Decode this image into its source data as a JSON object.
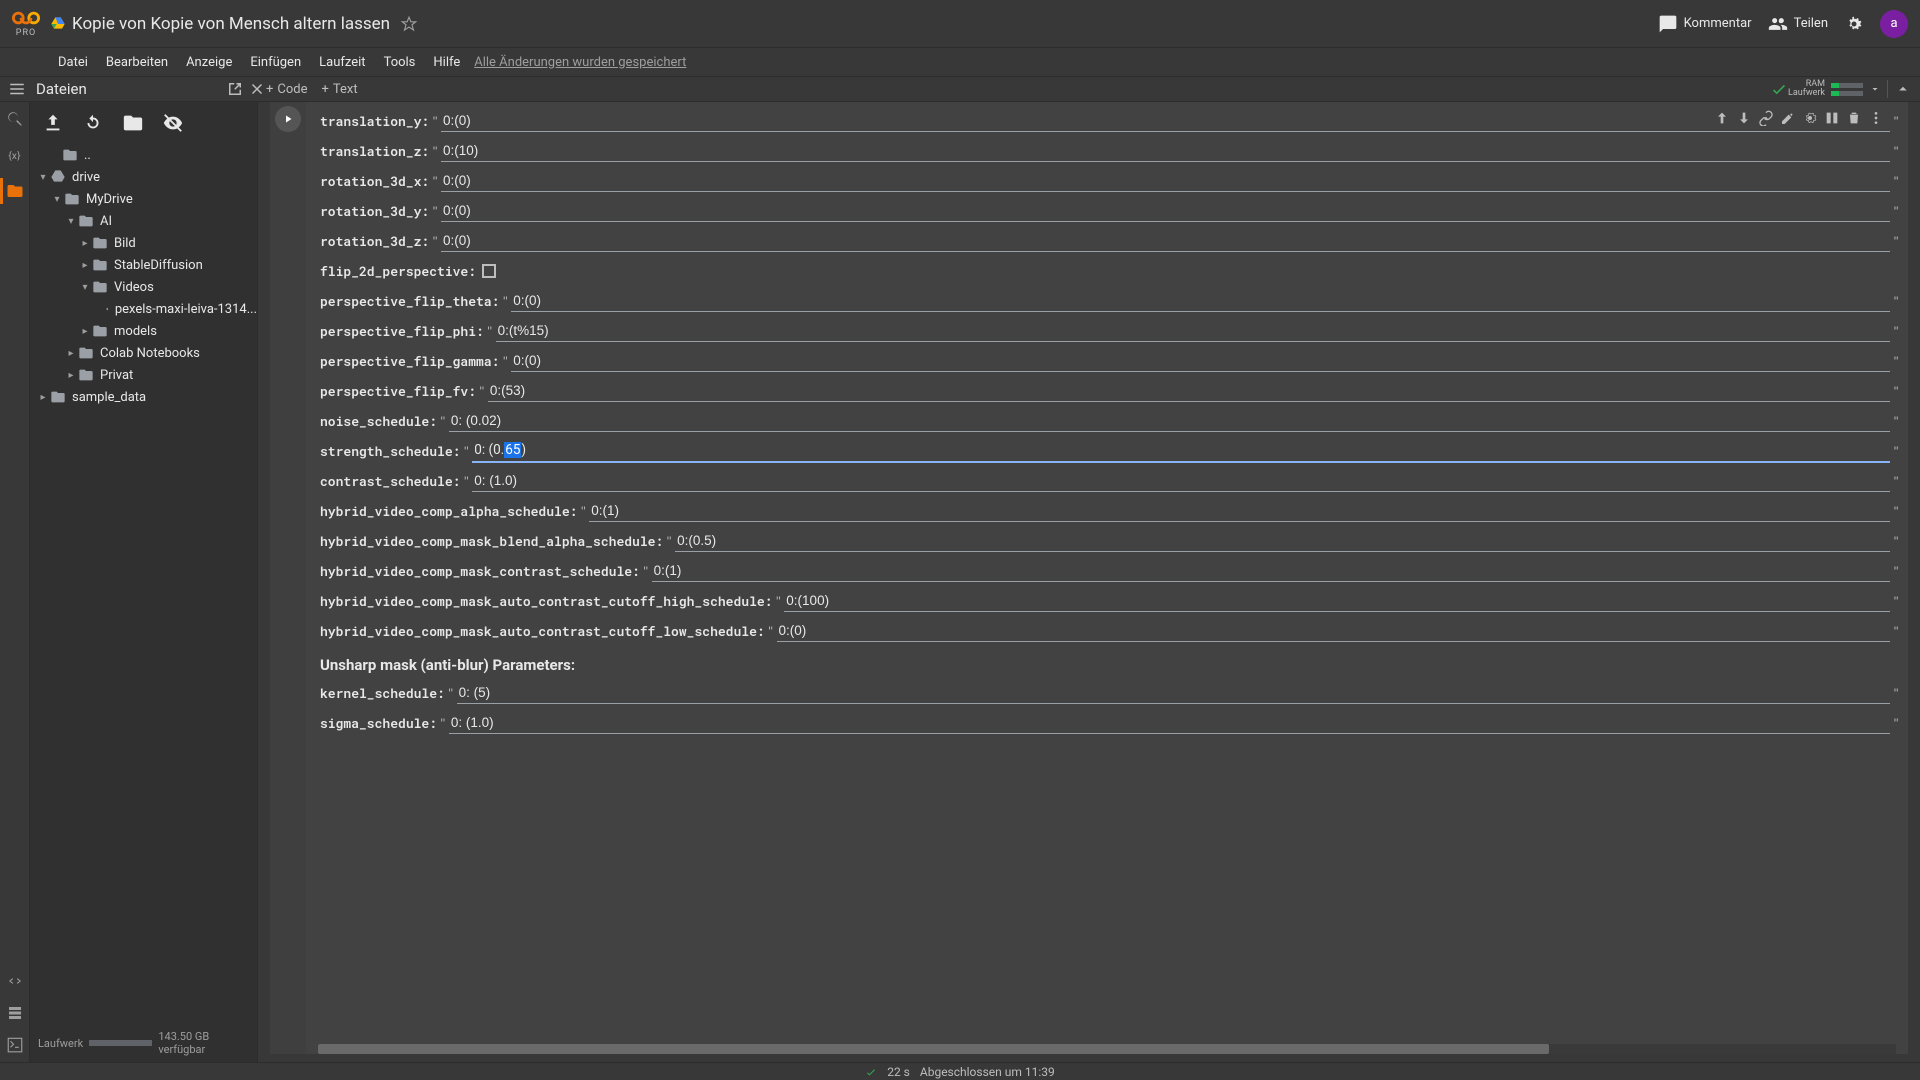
{
  "header": {
    "pro_label": "PRO",
    "doc_title": "Kopie von Kopie von Mensch altern lassen",
    "comment": "Kommentar",
    "share": "Teilen",
    "avatar": "a"
  },
  "menu": {
    "items": [
      "Datei",
      "Bearbeiten",
      "Anzeige",
      "Einfügen",
      "Laufzeit",
      "Tools",
      "Hilfe"
    ],
    "saved": "Alle Änderungen wurden gespeichert"
  },
  "toolrow": {
    "files_title": "Dateien",
    "add_code": "Code",
    "add_text": "Text",
    "ram": "RAM",
    "disk": "Laufwerk"
  },
  "sidebar": {
    "footer_label": "Laufwerk",
    "footer_free": "143.50 GB verfügbar",
    "tree": {
      "dots": "..",
      "drive": "drive",
      "mydrive": "MyDrive",
      "ai": "AI",
      "bild": "Bild",
      "stable": "StableDiffusion",
      "videos": "Videos",
      "videofile": "pexels-maxi-leiva-1314...",
      "models": "models",
      "colab": "Colab Notebooks",
      "privat": "Privat",
      "sample": "sample_data"
    }
  },
  "form": {
    "translation_y": {
      "label": "translation_y:",
      "value": "0:(0)"
    },
    "translation_z": {
      "label": "translation_z:",
      "value": "0:(10)"
    },
    "rotation_3d_x": {
      "label": "rotation_3d_x:",
      "value": "0:(0)"
    },
    "rotation_3d_y": {
      "label": "rotation_3d_y:",
      "value": "0:(0)"
    },
    "rotation_3d_z": {
      "label": "rotation_3d_z:",
      "value": "0:(0)"
    },
    "flip_2d_perspective": {
      "label": "flip_2d_perspective:"
    },
    "perspective_flip_theta": {
      "label": "perspective_flip_theta:",
      "value": "0:(0)"
    },
    "perspective_flip_phi": {
      "label": "perspective_flip_phi:",
      "value": "0:(t%15)"
    },
    "perspective_flip_gamma": {
      "label": "perspective_flip_gamma:",
      "value": "0:(0)"
    },
    "perspective_flip_fv": {
      "label": "perspective_flip_fv:",
      "value": "0:(53)"
    },
    "noise_schedule": {
      "label": "noise_schedule:",
      "value": "0: (0.02)"
    },
    "strength_schedule": {
      "label": "strength_schedule:",
      "pre": "0: (0.",
      "sel": "65",
      "post": ")"
    },
    "contrast_schedule": {
      "label": "contrast_schedule:",
      "value": "0: (1.0)"
    },
    "hybrid_alpha": {
      "label": "hybrid_video_comp_alpha_schedule:",
      "value": "0:(1)"
    },
    "hybrid_mask_blend": {
      "label": "hybrid_video_comp_mask_blend_alpha_schedule:",
      "value": "0:(0.5)"
    },
    "hybrid_mask_contrast": {
      "label": "hybrid_video_comp_mask_contrast_schedule:",
      "value": "0:(1)"
    },
    "hybrid_mask_high": {
      "label": "hybrid_video_comp_mask_auto_contrast_cutoff_high_schedule:",
      "value": "0:(100)"
    },
    "hybrid_mask_low": {
      "label": "hybrid_video_comp_mask_auto_contrast_cutoff_low_schedule:",
      "value": "0:(0)"
    },
    "section_unsharp": "Unsharp mask (anti-blur) Parameters:",
    "kernel_schedule": {
      "label": "kernel_schedule:",
      "value": "0: (5)"
    },
    "sigma_schedule": {
      "label": "sigma_schedule:",
      "value": "0: (1.0)"
    }
  },
  "status": {
    "time": "22 s",
    "done": "Abgeschlossen um 11:39"
  }
}
